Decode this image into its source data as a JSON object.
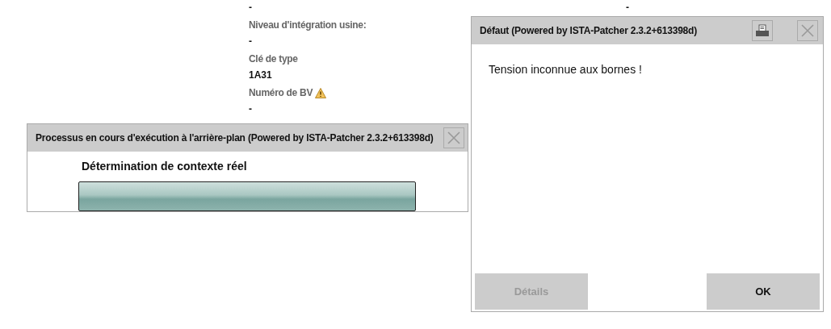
{
  "background": {
    "fields": [
      {
        "value": "-"
      },
      {
        "label": "Niveau d'intégration usine:",
        "value": "-"
      },
      {
        "label": "Clé de type",
        "value": "1A31"
      },
      {
        "label": "Numéro de BV",
        "warning": true,
        "value": "-"
      }
    ],
    "side_value": "-"
  },
  "progress_dialog": {
    "title": "Processus en cours d'exécution à l'arrière-plan (Powered by ISTA-Patcher 2.3.2+613398d)",
    "message": "Détermination de contexte réel"
  },
  "error_dialog": {
    "title": "Défaut (Powered by ISTA-Patcher 2.3.2+613398d)",
    "message": "Tension inconnue aux bornes !",
    "buttons": [
      {
        "label": "Détails",
        "disabled": true
      },
      {
        "label": "OK",
        "disabled": false
      }
    ]
  }
}
